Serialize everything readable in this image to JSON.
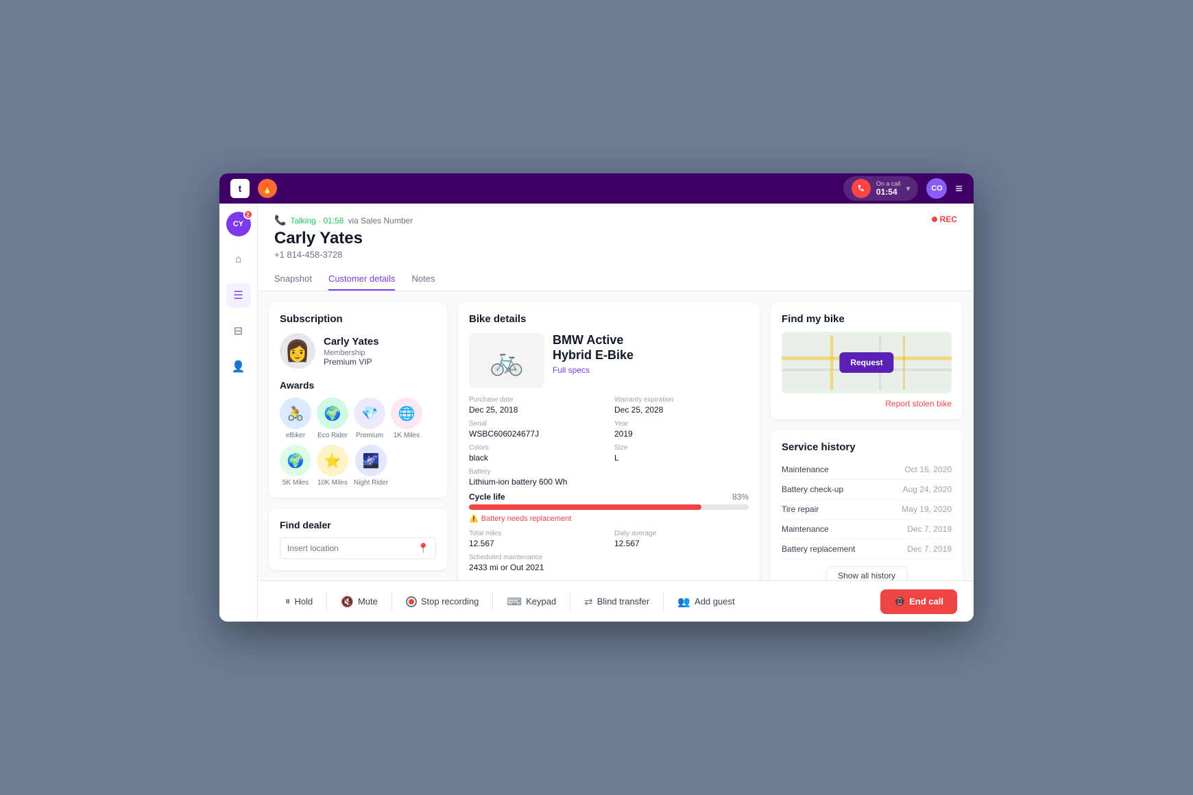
{
  "topBar": {
    "logoText": "t",
    "callStatus": "On a call",
    "callTime": "01:54",
    "avatarInitials": "CO"
  },
  "sidebar": {
    "avatarInitials": "CY",
    "badgeCount": "2"
  },
  "caller": {
    "talkingLabel": "Talking · 01:58",
    "viaSales": "via Sales Number",
    "name": "Carly Yates",
    "phone": "+1 814-458-3728",
    "recLabel": "REC",
    "tabs": [
      "Snapshot",
      "Customer details",
      "Notes"
    ],
    "activeTab": "Customer details"
  },
  "subscription": {
    "title": "Subscription",
    "name": "Carly Yates",
    "membershipLabel": "Membership",
    "tier": "Premium VIP"
  },
  "awards": {
    "title": "Awards",
    "items": [
      {
        "label": "eBiker",
        "emoji": "🚴",
        "bg": "#dbeafe"
      },
      {
        "label": "Eco Rider",
        "emoji": "🌍",
        "bg": "#d1fae5"
      },
      {
        "label": "Premium",
        "emoji": "💎",
        "bg": "#ede9fe"
      },
      {
        "label": "1K Miles",
        "emoji": "🌐",
        "bg": "#fce7f3"
      },
      {
        "label": "5K Miles",
        "emoji": "🌍",
        "bg": "#dcfce7"
      },
      {
        "label": "10K Miles",
        "emoji": "⭐",
        "bg": "#fef3c7"
      },
      {
        "label": "Night Rider",
        "emoji": "🌌",
        "bg": "#e0e7ff"
      }
    ]
  },
  "findDealer": {
    "title": "Find dealer",
    "placeholder": "Insert location"
  },
  "bikeDetails": {
    "title": "Bike details",
    "name": "BMW Active\nHybrid E-Bike",
    "specsLink": "Full specs",
    "purchaseDateLabel": "Purchase date",
    "purchaseDate": "Dec 25, 2018",
    "warrantyLabel": "Warranty expiration",
    "warrantyDate": "Dec 25, 2028",
    "serialLabel": "Serial",
    "serial": "WSBC606024677J",
    "yearLabel": "Year",
    "year": "2019",
    "colorsLabel": "Colors",
    "colors": "black",
    "sizeLabel": "Size",
    "size": "L",
    "batteryLabel": "Battery",
    "battery": "Lithium-ion battery 600 Wh",
    "cycleLifeLabel": "Cycle life",
    "cycleLifePct": "83%",
    "cycleLifeValue": 83,
    "batteryWarning": "Battery needs replacement",
    "totalMilesLabel": "Total miles",
    "totalMiles": "12.567",
    "dailyAvgLabel": "Daily average",
    "dailyAvg": "12.567",
    "scheduledLabel": "Scheduled maintenance",
    "scheduled": "2433 mi or Out 2021"
  },
  "findBike": {
    "title": "Find my bike",
    "requestLabel": "Request",
    "reportLabel": "Report stolen bike"
  },
  "serviceHistory": {
    "title": "Service history",
    "items": [
      {
        "name": "Maintenance",
        "date": "Oct 16, 2020"
      },
      {
        "name": "Battery check-up",
        "date": "Aug 24, 2020"
      },
      {
        "name": "Tire repair",
        "date": "May 19, 2020"
      },
      {
        "name": "Maintenance",
        "date": "Dec 7, 2019"
      },
      {
        "name": "Battery replacement",
        "date": "Dec 7, 2019"
      }
    ],
    "showAllLabel": "Show all history"
  },
  "toolbar": {
    "hold": "Hold",
    "mute": "Mute",
    "stopRecording": "Stop recording",
    "keypad": "Keypad",
    "blindTransfer": "Blind transfer",
    "addGuest": "Add guest",
    "endCall": "End call"
  }
}
